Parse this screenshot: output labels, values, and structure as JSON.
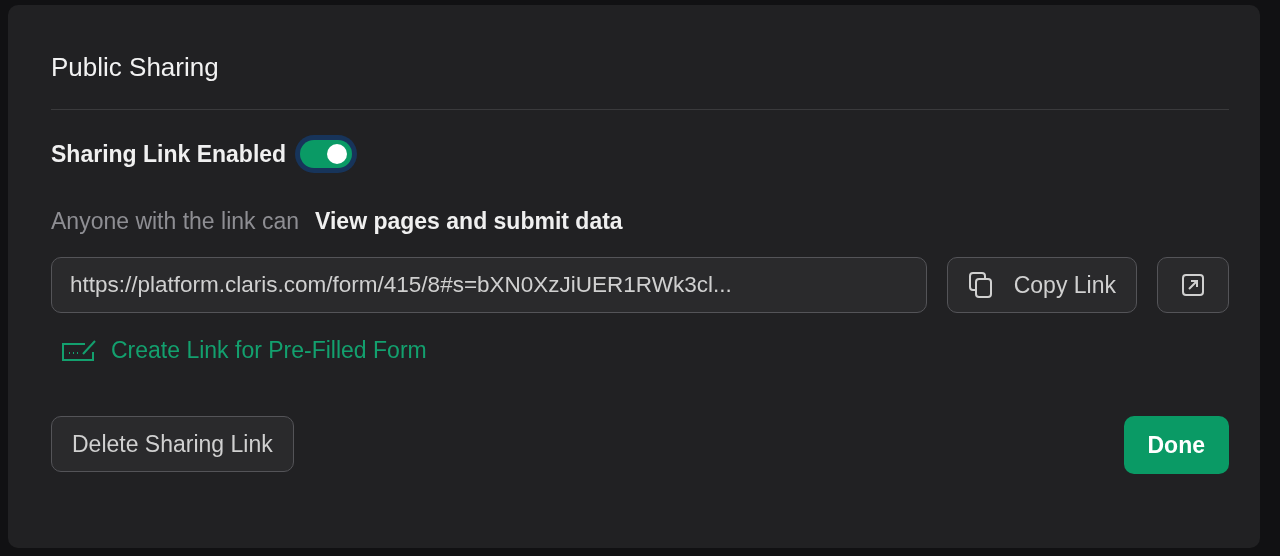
{
  "dialog": {
    "title": "Public Sharing"
  },
  "sharing_toggle": {
    "label": "Sharing Link Enabled",
    "on": true
  },
  "permission": {
    "label": "Anyone with the link can",
    "value": "View pages and submit data"
  },
  "link_field": {
    "value": "https://platform.claris.com/form/415/8#s=bXN0XzJiUER1RWk3cl..."
  },
  "copy_button": {
    "label": "Copy Link"
  },
  "prefill_link": {
    "label": "Create Link for Pre-Filled Form"
  },
  "footer": {
    "delete_button": "Delete Sharing Link",
    "done_button": "Done"
  }
}
